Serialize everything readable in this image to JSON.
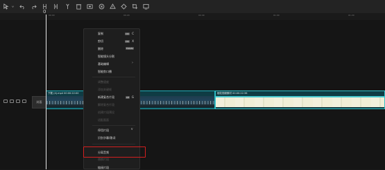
{
  "toolbar": {
    "icons": [
      "select-icon",
      "undo-icon",
      "redo-icon",
      "split-icon",
      "split-left-icon",
      "split-right-icon",
      "delete-icon",
      "freeze-icon",
      "mirror-icon",
      "rotate-icon",
      "crop-icon",
      "fit-icon"
    ]
  },
  "ruler": {
    "playhead_label": "0",
    "ticks": [
      "00:00",
      "00:20",
      "00:40",
      "01:00",
      "01:20",
      "01:40"
    ]
  },
  "track": {
    "cover_label": "封面"
  },
  "clips": {
    "a": {
      "label": "下载 (4).mp4   00:00:22:00"
    },
    "b": {
      "label": "烟花视频素材   00:00:22:36"
    }
  },
  "menu": {
    "copy": "复制",
    "copy_key": "Ctrl",
    "copy_letter": "C",
    "cut": "剪切",
    "cut_key": "Ctrl",
    "cut_letter": "X",
    "delete": "删除",
    "delete_key": "Delete",
    "smart_split": "智能镜头分割",
    "basic_edit": "基础编辑",
    "smart_subtitle": "智能剪口播",
    "disabled1": "调整速度",
    "disabled2": "添加关键帧",
    "new_compound": "新建复合片段",
    "new_compound_key": "Alt",
    "new_compound_letter": "G",
    "disabled3": "解除复合片段",
    "disabled4": "创建片段预设",
    "disabled5": "适配画面",
    "disabled6": "链接到媒体",
    "clip_edit": "停用片段",
    "subtitle": "识别字幕/歌词",
    "separate_audio": "分离音频",
    "disabled7": "替换片段",
    "bottom": "链接片段"
  }
}
